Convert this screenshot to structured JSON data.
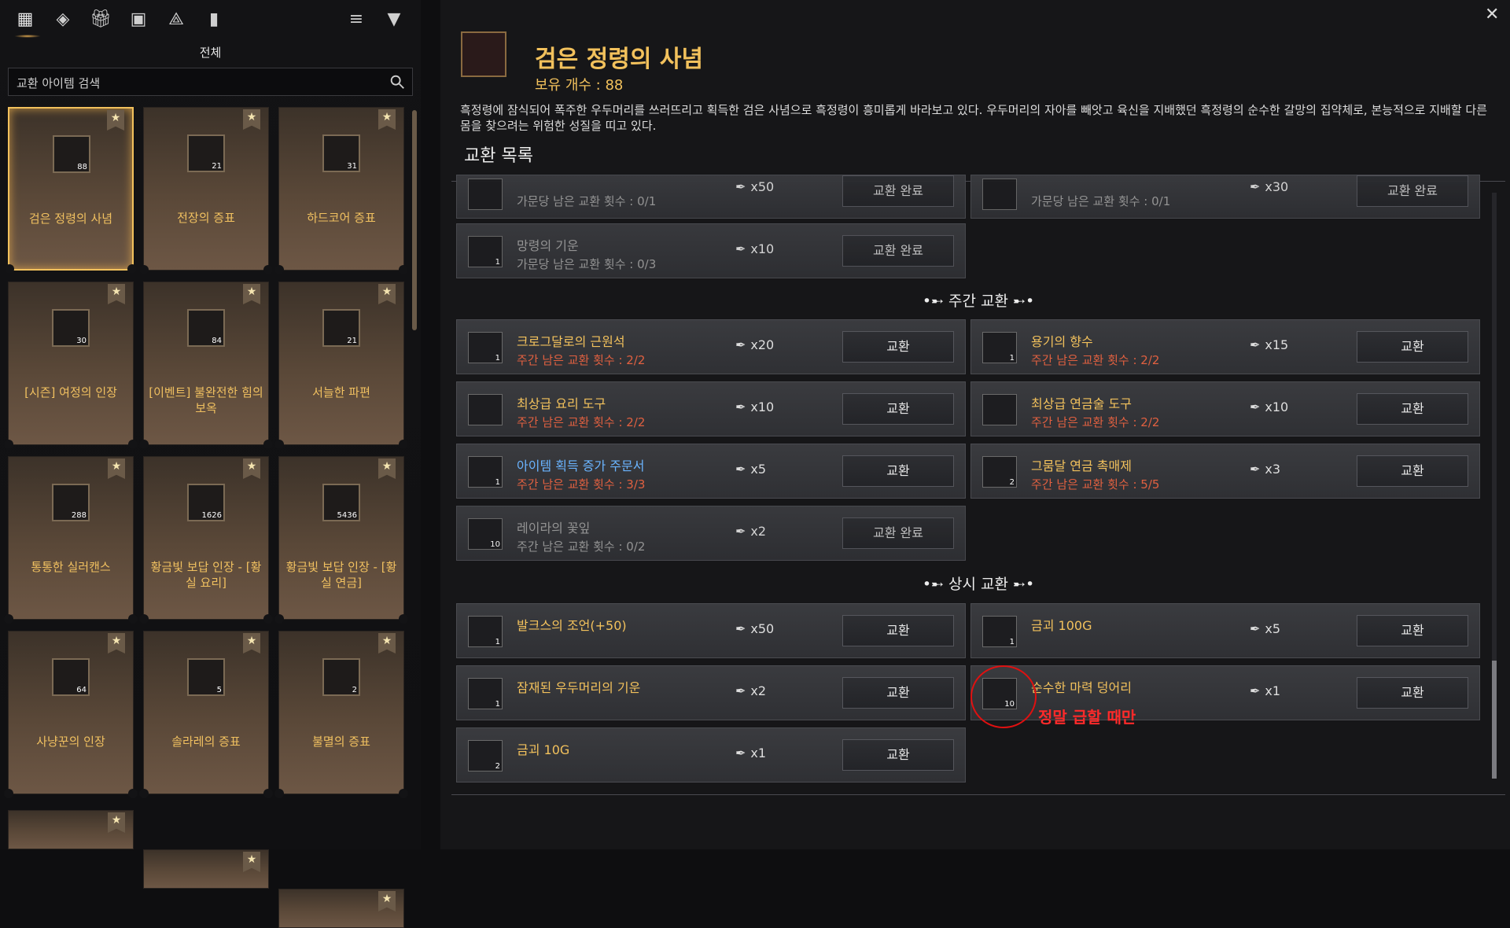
{
  "top_bar": {
    "category_label": "전체",
    "search_placeholder": "교환 아이템 검색"
  },
  "left_cards": [
    {
      "name": "검은 정령의 사념",
      "count": "88",
      "selected": true
    },
    {
      "name": "전장의 증표",
      "count": "21"
    },
    {
      "name": "하드코어 증표",
      "count": "31"
    },
    {
      "name": "[시즌] 여정의 인장",
      "count": "30"
    },
    {
      "name": "[이벤트] 불완전한 힘의 보옥",
      "count": "84"
    },
    {
      "name": "서늘한 파편",
      "count": "21"
    },
    {
      "name": "통통한 실러캔스",
      "count": "288"
    },
    {
      "name": "황금빛 보답 인장 - [황실 요리]",
      "count": "1626"
    },
    {
      "name": "황금빛 보답 인장 - [황실 연금]",
      "count": "5436"
    },
    {
      "name": "사냥꾼의 인장",
      "count": "64"
    },
    {
      "name": "솔라레의 증표",
      "count": "5"
    },
    {
      "name": "불멸의 증표",
      "count": "2"
    }
  ],
  "detail": {
    "title": "검은 정령의 사념",
    "owned": "보유 개수 : 88",
    "description": "흑정령에 잠식되어 폭주한 우두머리를 쓰러뜨리고 획득한 검은 사념으로 흑정령이 흥미롭게 바라보고 있다. 우두머리의 자아를 빼앗고 육신을 지배했던 흑정령의 순수한 갈망의 집약체로, 본능적으로 지배할 다른 몸을 찾으려는 위험한 성질을 띠고 있다.",
    "list_title": "교환 목록"
  },
  "sections": {
    "weekly": "주간 교환",
    "permanent": "상시 교환"
  },
  "slots": {
    "top_left": {
      "sub": "가문당 남은 교환 횟수 : 0/1",
      "cost": "x50",
      "button": "교환 완료"
    },
    "top_right": {
      "sub": "가문당 남은 교환 횟수 : 0/1",
      "cost": "x30",
      "button": "교환 완료"
    },
    "mangryeong": {
      "name": "망령의 기운",
      "sub": "가문당 남은 교환 횟수 : 0/3",
      "cost": "x10",
      "button": "교환 완료",
      "qty": "1"
    },
    "w1": {
      "name": "크로그달로의 근원석",
      "sub": "주간 남은 교환 횟수 : 2/2",
      "cost": "x20",
      "button": "교환",
      "qty": "1"
    },
    "w2": {
      "name": "용기의 향수",
      "sub": "주간 남은 교환 횟수 : 2/2",
      "cost": "x15",
      "button": "교환",
      "qty": "1"
    },
    "w3": {
      "name": "최상급 요리 도구",
      "sub": "주간 남은 교환 횟수 : 2/2",
      "cost": "x10",
      "button": "교환",
      "qty": ""
    },
    "w4": {
      "name": "최상급 연금술 도구",
      "sub": "주간 남은 교환 횟수 : 2/2",
      "cost": "x10",
      "button": "교환",
      "qty": ""
    },
    "w5": {
      "name": "아이템 획득 증가 주문서",
      "sub": "주간 남은 교환 횟수 : 3/3",
      "cost": "x5",
      "button": "교환",
      "qty": "1"
    },
    "w6": {
      "name": "그뭄달 연금 촉매제",
      "sub": "주간 남은 교환 횟수 : 5/5",
      "cost": "x3",
      "button": "교환",
      "qty": "2"
    },
    "w7": {
      "name": "레이라의 꽃잎",
      "sub": "주간 남은 교환 횟수 : 0/2",
      "cost": "x2",
      "button": "교환 완료",
      "qty": "10"
    },
    "p1": {
      "name": "발크스의 조언(+50)",
      "cost": "x50",
      "button": "교환",
      "qty": "1"
    },
    "p2": {
      "name": "금괴 100G",
      "cost": "x5",
      "button": "교환",
      "qty": "1"
    },
    "p3": {
      "name": "잠재된 우두머리의 기운",
      "cost": "x2",
      "button": "교환",
      "qty": "1"
    },
    "p4": {
      "name": "순수한 마력 덩어리",
      "cost": "x1",
      "button": "교환",
      "qty": "10"
    },
    "p5": {
      "name": "금괴 10G",
      "cost": "x1",
      "button": "교환",
      "qty": "2"
    }
  },
  "annotation": "정말 급할 때만",
  "colors": {
    "accent": "#f2c15c",
    "warn": "#e06040",
    "link": "#6ab4ff",
    "annotation": "#ff2a2a"
  }
}
